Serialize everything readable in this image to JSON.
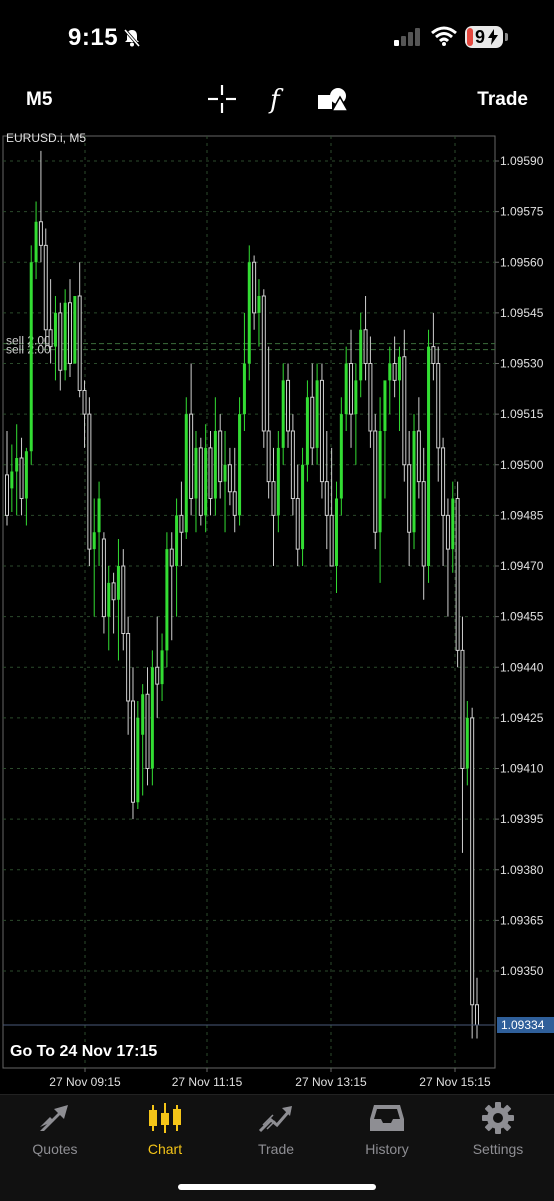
{
  "status_bar": {
    "time": "9:15",
    "battery": "9",
    "icons": [
      "bell-slash-icon",
      "cellular-signal-icon",
      "wifi-icon",
      "battery-icon"
    ]
  },
  "toolbar": {
    "timeframe": "M5",
    "tools": [
      "crosshair-icon",
      "function-icon",
      "objects-icon"
    ],
    "trade_label": "Trade"
  },
  "chart": {
    "symbol_label": "EURUSD.i, M5",
    "sell_label_1": "sell 2.00",
    "sell_label_2": "sell 2.00",
    "current_price": "1.09334",
    "goto_text": "Go To 24 Nov 17:15",
    "price_ticks": [
      "1.09590",
      "1.09575",
      "1.09560",
      "1.09545",
      "1.09530",
      "1.09515",
      "1.09500",
      "1.09485",
      "1.09470",
      "1.09455",
      "1.09440",
      "1.09425",
      "1.09410",
      "1.09395",
      "1.09380",
      "1.09365",
      "1.09350"
    ],
    "time_ticks": [
      "27 Nov 09:15",
      "27 Nov 11:15",
      "27 Nov 13:15",
      "27 Nov 15:15"
    ],
    "colors": {
      "bull": "#33dd33",
      "bear": "#cfcfcf",
      "grid": "#2b4a2b",
      "axis": "#666666",
      "current_price_bg": "#2f5f9a",
      "sell_line": "#3c6e3c"
    }
  },
  "chart_data": {
    "type": "candlestick",
    "symbol": "EURUSD.i",
    "timeframe": "M5",
    "ylim": [
      1.0932,
      1.0961
    ],
    "sell_level": 1.09535,
    "current_price": 1.09334,
    "candles": [
      {
        "o": 1.09497,
        "h": 1.0951,
        "l": 1.09482,
        "c": 1.09485
      },
      {
        "o": 1.09493,
        "h": 1.09506,
        "l": 1.09486,
        "c": 1.09498
      },
      {
        "o": 1.09498,
        "h": 1.09512,
        "l": 1.09485,
        "c": 1.09502
      },
      {
        "o": 1.09502,
        "h": 1.09508,
        "l": 1.09485,
        "c": 1.0949
      },
      {
        "o": 1.0949,
        "h": 1.09505,
        "l": 1.09482,
        "c": 1.09504
      },
      {
        "o": 1.09504,
        "h": 1.09565,
        "l": 1.095,
        "c": 1.0956
      },
      {
        "o": 1.0956,
        "h": 1.09578,
        "l": 1.09555,
        "c": 1.09572
      },
      {
        "o": 1.09572,
        "h": 1.09593,
        "l": 1.0956,
        "c": 1.09565
      },
      {
        "o": 1.09565,
        "h": 1.0957,
        "l": 1.09535,
        "c": 1.0954
      },
      {
        "o": 1.0954,
        "h": 1.09555,
        "l": 1.0953,
        "c": 1.09535
      },
      {
        "o": 1.09535,
        "h": 1.0955,
        "l": 1.09525,
        "c": 1.09545
      },
      {
        "o": 1.09545,
        "h": 1.09548,
        "l": 1.09522,
        "c": 1.09528
      },
      {
        "o": 1.09528,
        "h": 1.09552,
        "l": 1.09525,
        "c": 1.09548
      },
      {
        "o": 1.09548,
        "h": 1.09555,
        "l": 1.09526,
        "c": 1.0953
      },
      {
        "o": 1.0953,
        "h": 1.0955,
        "l": 1.09532,
        "c": 1.0955
      },
      {
        "o": 1.0955,
        "h": 1.0956,
        "l": 1.0952,
        "c": 1.09522
      },
      {
        "o": 1.09522,
        "h": 1.09525,
        "l": 1.09505,
        "c": 1.09515
      },
      {
        "o": 1.09515,
        "h": 1.0952,
        "l": 1.0947,
        "c": 1.09475
      },
      {
        "o": 1.09475,
        "h": 1.0949,
        "l": 1.09455,
        "c": 1.0948
      },
      {
        "o": 1.0948,
        "h": 1.09495,
        "l": 1.0947,
        "c": 1.0949
      },
      {
        "o": 1.09478,
        "h": 1.0948,
        "l": 1.0945,
        "c": 1.09455
      },
      {
        "o": 1.09455,
        "h": 1.0947,
        "l": 1.09445,
        "c": 1.09465
      },
      {
        "o": 1.09465,
        "h": 1.09468,
        "l": 1.0945,
        "c": 1.0946
      },
      {
        "o": 1.0946,
        "h": 1.09478,
        "l": 1.09442,
        "c": 1.0947
      },
      {
        "o": 1.0947,
        "h": 1.09475,
        "l": 1.09445,
        "c": 1.0945
      },
      {
        "o": 1.0945,
        "h": 1.09455,
        "l": 1.0942,
        "c": 1.0943
      },
      {
        "o": 1.0943,
        "h": 1.0944,
        "l": 1.09395,
        "c": 1.094
      },
      {
        "o": 1.094,
        "h": 1.0943,
        "l": 1.09398,
        "c": 1.09425
      },
      {
        "o": 1.0942,
        "h": 1.09435,
        "l": 1.09402,
        "c": 1.09432
      },
      {
        "o": 1.09432,
        "h": 1.0944,
        "l": 1.09405,
        "c": 1.0941
      },
      {
        "o": 1.0941,
        "h": 1.09445,
        "l": 1.09405,
        "c": 1.0944
      },
      {
        "o": 1.0944,
        "h": 1.09455,
        "l": 1.09425,
        "c": 1.09435
      },
      {
        "o": 1.09435,
        "h": 1.0945,
        "l": 1.0943,
        "c": 1.09445
      },
      {
        "o": 1.09445,
        "h": 1.0948,
        "l": 1.0944,
        "c": 1.09475
      },
      {
        "o": 1.09475,
        "h": 1.0948,
        "l": 1.09448,
        "c": 1.0947
      },
      {
        "o": 1.0947,
        "h": 1.0949,
        "l": 1.09455,
        "c": 1.09485
      },
      {
        "o": 1.09485,
        "h": 1.09495,
        "l": 1.0947,
        "c": 1.0948
      },
      {
        "o": 1.0948,
        "h": 1.0952,
        "l": 1.09478,
        "c": 1.09515
      },
      {
        "o": 1.09515,
        "h": 1.0953,
        "l": 1.09485,
        "c": 1.0949
      },
      {
        "o": 1.0949,
        "h": 1.0951,
        "l": 1.0948,
        "c": 1.09505
      },
      {
        "o": 1.09505,
        "h": 1.09508,
        "l": 1.09482,
        "c": 1.09485
      },
      {
        "o": 1.09485,
        "h": 1.09512,
        "l": 1.0948,
        "c": 1.09505
      },
      {
        "o": 1.09505,
        "h": 1.0951,
        "l": 1.09485,
        "c": 1.0949
      },
      {
        "o": 1.0949,
        "h": 1.0952,
        "l": 1.09485,
        "c": 1.0951
      },
      {
        "o": 1.0951,
        "h": 1.09515,
        "l": 1.0949,
        "c": 1.09495
      },
      {
        "o": 1.09495,
        "h": 1.0951,
        "l": 1.0948,
        "c": 1.095
      },
      {
        "o": 1.095,
        "h": 1.09505,
        "l": 1.09488,
        "c": 1.09492
      },
      {
        "o": 1.09492,
        "h": 1.09505,
        "l": 1.0948,
        "c": 1.09485
      },
      {
        "o": 1.09485,
        "h": 1.0952,
        "l": 1.09482,
        "c": 1.09515
      },
      {
        "o": 1.09515,
        "h": 1.09545,
        "l": 1.0951,
        "c": 1.0953
      },
      {
        "o": 1.0953,
        "h": 1.09565,
        "l": 1.09525,
        "c": 1.0956
      },
      {
        "o": 1.0956,
        "h": 1.09562,
        "l": 1.0954,
        "c": 1.09545
      },
      {
        "o": 1.09545,
        "h": 1.09555,
        "l": 1.09535,
        "c": 1.0955
      },
      {
        "o": 1.0955,
        "h": 1.09552,
        "l": 1.09505,
        "c": 1.0951
      },
      {
        "o": 1.0951,
        "h": 1.09535,
        "l": 1.0949,
        "c": 1.09495
      },
      {
        "o": 1.09495,
        "h": 1.09505,
        "l": 1.0947,
        "c": 1.09485
      },
      {
        "o": 1.09485,
        "h": 1.0951,
        "l": 1.0948,
        "c": 1.09505
      },
      {
        "o": 1.09505,
        "h": 1.0953,
        "l": 1.095,
        "c": 1.09525
      },
      {
        "o": 1.09525,
        "h": 1.0953,
        "l": 1.09505,
        "c": 1.0951
      },
      {
        "o": 1.0951,
        "h": 1.09515,
        "l": 1.09485,
        "c": 1.0949
      },
      {
        "o": 1.0949,
        "h": 1.095,
        "l": 1.0947,
        "c": 1.09475
      },
      {
        "o": 1.09475,
        "h": 1.09505,
        "l": 1.0947,
        "c": 1.095
      },
      {
        "o": 1.095,
        "h": 1.09525,
        "l": 1.09495,
        "c": 1.0952
      },
      {
        "o": 1.0952,
        "h": 1.0953,
        "l": 1.095,
        "c": 1.09505
      },
      {
        "o": 1.09505,
        "h": 1.0953,
        "l": 1.095,
        "c": 1.09525
      },
      {
        "o": 1.09525,
        "h": 1.0953,
        "l": 1.0949,
        "c": 1.09495
      },
      {
        "o": 1.09495,
        "h": 1.0951,
        "l": 1.09475,
        "c": 1.09485
      },
      {
        "o": 1.09485,
        "h": 1.09505,
        "l": 1.0947,
        "c": 1.0947
      },
      {
        "o": 1.0947,
        "h": 1.09495,
        "l": 1.09462,
        "c": 1.0949
      },
      {
        "o": 1.0949,
        "h": 1.0952,
        "l": 1.09485,
        "c": 1.09515
      },
      {
        "o": 1.09515,
        "h": 1.09535,
        "l": 1.0951,
        "c": 1.0953
      },
      {
        "o": 1.0953,
        "h": 1.0954,
        "l": 1.09505,
        "c": 1.09515
      },
      {
        "o": 1.09515,
        "h": 1.0953,
        "l": 1.095,
        "c": 1.09525
      },
      {
        "o": 1.09525,
        "h": 1.09545,
        "l": 1.0952,
        "c": 1.0954
      },
      {
        "o": 1.0954,
        "h": 1.0955,
        "l": 1.09525,
        "c": 1.0953
      },
      {
        "o": 1.0953,
        "h": 1.09538,
        "l": 1.09505,
        "c": 1.0951
      },
      {
        "o": 1.0951,
        "h": 1.09515,
        "l": 1.09475,
        "c": 1.0948
      },
      {
        "o": 1.0948,
        "h": 1.0952,
        "l": 1.09465,
        "c": 1.0951
      },
      {
        "o": 1.0951,
        "h": 1.0952,
        "l": 1.0949,
        "c": 1.09525
      },
      {
        "o": 1.09525,
        "h": 1.09535,
        "l": 1.09515,
        "c": 1.0953
      },
      {
        "o": 1.0953,
        "h": 1.09538,
        "l": 1.0952,
        "c": 1.09525
      },
      {
        "o": 1.09525,
        "h": 1.09535,
        "l": 1.0951,
        "c": 1.09532
      },
      {
        "o": 1.09532,
        "h": 1.0954,
        "l": 1.09495,
        "c": 1.095
      },
      {
        "o": 1.095,
        "h": 1.0951,
        "l": 1.0947,
        "c": 1.0948
      },
      {
        "o": 1.0948,
        "h": 1.09515,
        "l": 1.09475,
        "c": 1.0951
      },
      {
        "o": 1.0951,
        "h": 1.0952,
        "l": 1.0949,
        "c": 1.09495
      },
      {
        "o": 1.09495,
        "h": 1.09505,
        "l": 1.0946,
        "c": 1.0947
      },
      {
        "o": 1.0947,
        "h": 1.0954,
        "l": 1.09465,
        "c": 1.09535
      },
      {
        "o": 1.09535,
        "h": 1.09545,
        "l": 1.09525,
        "c": 1.0953
      },
      {
        "o": 1.0953,
        "h": 1.09535,
        "l": 1.09495,
        "c": 1.09505
      },
      {
        "o": 1.09505,
        "h": 1.09508,
        "l": 1.0947,
        "c": 1.09485
      },
      {
        "o": 1.09485,
        "h": 1.0949,
        "l": 1.09455,
        "c": 1.09475
      },
      {
        "o": 1.09475,
        "h": 1.09495,
        "l": 1.09468,
        "c": 1.0949
      },
      {
        "o": 1.0949,
        "h": 1.09495,
        "l": 1.0944,
        "c": 1.09445
      },
      {
        "o": 1.09445,
        "h": 1.09455,
        "l": 1.09385,
        "c": 1.0941
      },
      {
        "o": 1.0941,
        "h": 1.0943,
        "l": 1.09405,
        "c": 1.09425
      },
      {
        "o": 1.09425,
        "h": 1.09428,
        "l": 1.0933,
        "c": 1.0934
      },
      {
        "o": 1.0934,
        "h": 1.09348,
        "l": 1.0933,
        "c": 1.09334
      }
    ],
    "yticks": [
      1.0959,
      1.09575,
      1.0956,
      1.09545,
      1.0953,
      1.09515,
      1.095,
      1.09485,
      1.0947,
      1.09455,
      1.0944,
      1.09425,
      1.0941,
      1.09395,
      1.0938,
      1.09365,
      1.0935
    ],
    "xticks": [
      "27 Nov 09:15",
      "27 Nov 11:15",
      "27 Nov 13:15",
      "27 Nov 15:15"
    ],
    "grid": true
  },
  "tab_bar": {
    "tabs": [
      {
        "label": "Quotes",
        "icon": "quotes-arrows-icon",
        "active": false
      },
      {
        "label": "Chart",
        "icon": "candlestick-chart-icon",
        "active": true
      },
      {
        "label": "Trade",
        "icon": "trade-trend-icon",
        "active": false
      },
      {
        "label": "History",
        "icon": "history-inbox-icon",
        "active": false
      },
      {
        "label": "Settings",
        "icon": "settings-gear-icon",
        "active": false
      }
    ]
  }
}
